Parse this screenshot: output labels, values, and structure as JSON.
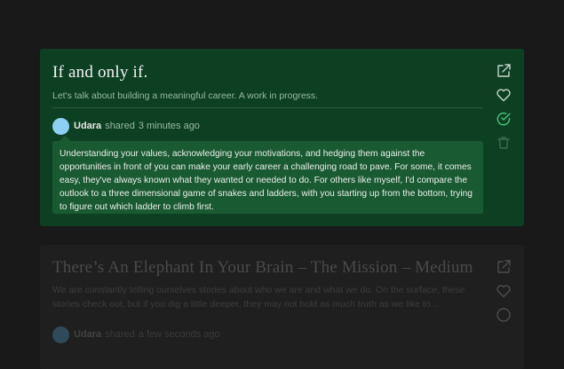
{
  "posts": [
    {
      "title": "If and only if.",
      "subtitle": "Let's talk about building a meaningful career. A work in progress.",
      "shared_by": "Udara",
      "shared_verb": "shared",
      "shared_time": "3 minutes ago",
      "comment": "Understanding your values, acknowledging your motivations, and hedging them against the opportunities in front of you can make your early career a challenging road to pave. For some, it comes easy, they've always known what they wanted or needed to do. For others like myself, I'd compare the outlook to a three dimensional game of snakes and ladders, with you starting up from the bottom, trying to figure out which ladder to climb first.",
      "icons": [
        "external-link-icon",
        "heart-icon",
        "check-circle-icon",
        "trash-icon"
      ]
    },
    {
      "title": "There’s An Elephant In Your Brain – The Mission – Medium",
      "subtitle": "We are constantly telling ourselves stories about who we are and what we do. On the surface, these stories check out, but if you dig a little deeper, they may not hold as much truth as we like to...",
      "shared_by": "Udara",
      "shared_verb": "shared",
      "shared_time": "a few seconds ago",
      "icons": [
        "external-link-icon",
        "heart-icon",
        "circle-icon"
      ]
    }
  ],
  "colors": {
    "background": "#191919",
    "active_card": "#0d4023",
    "comment_bubble": "#1a5a33",
    "inactive_card": "#1f1f1f",
    "avatar": "#8ed0f3"
  }
}
